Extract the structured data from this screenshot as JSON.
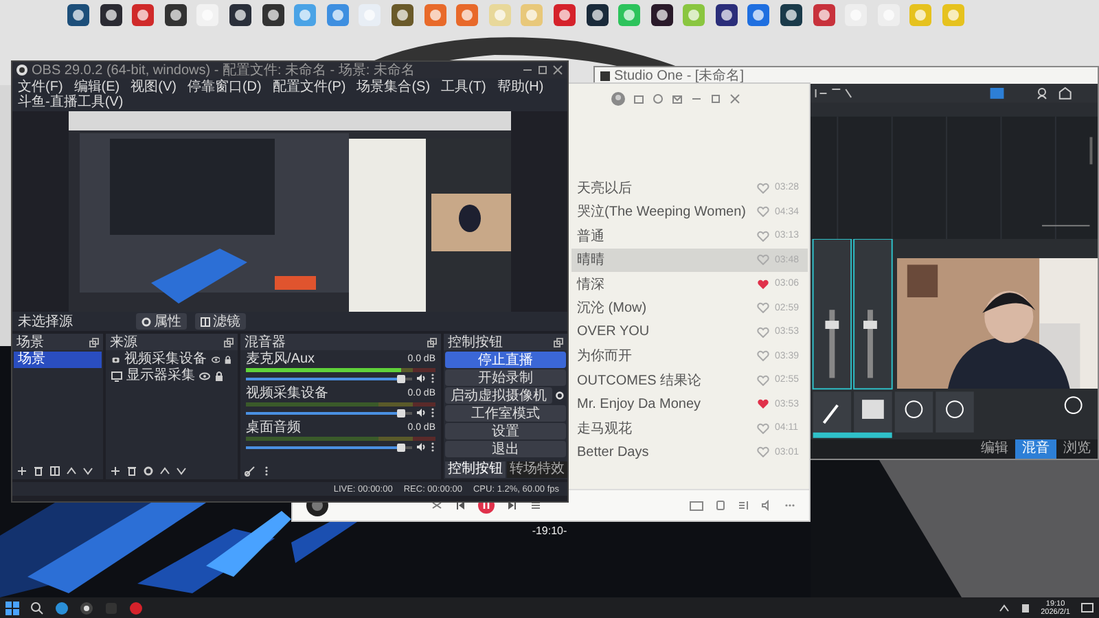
{
  "obs": {
    "title": "OBS 29.0.2 (64-bit, windows) - 配置文件: 未命名 - 场景: 未命名",
    "menu": [
      "文件(F)",
      "编辑(E)",
      "视图(V)",
      "停靠窗口(D)",
      "配置文件(P)",
      "场景集合(S)",
      "工具(T)",
      "帮助(H)",
      "斗鱼-直播工具(V)"
    ],
    "source_toolbar": {
      "no_source": "未选择源",
      "properties": "属性",
      "filters": "滤镜"
    },
    "scenes": {
      "title": "场景",
      "items": [
        {
          "label": "场景",
          "selected": true
        }
      ]
    },
    "sources": {
      "title": "来源",
      "items": [
        {
          "label": "视频采集设备",
          "kind": "camera"
        },
        {
          "label": "显示器采集",
          "kind": "display"
        }
      ]
    },
    "mixer": {
      "title": "混音器",
      "channels": [
        {
          "name": "麦克风/Aux",
          "reading": "0.0 dB",
          "meter": {
            "level": 0.82
          },
          "volume": {
            "level": 0.93
          }
        },
        {
          "name": "视频采集设备",
          "reading": "0.0 dB",
          "meter": {
            "level": 0
          },
          "volume": {
            "level": 0.93
          }
        },
        {
          "name": "桌面音频",
          "reading": "0.0 dB",
          "meter": {
            "level": 0
          },
          "volume": {
            "level": 0.93
          }
        }
      ]
    },
    "controls": {
      "title": "控制按钮",
      "buttons": [
        {
          "label": "停止直播",
          "kind": "primary"
        },
        {
          "label": "开始录制",
          "kind": "plain"
        },
        {
          "label": "启动虚拟摄像机",
          "kind": "gear"
        },
        {
          "label": "工作室模式",
          "kind": "plain"
        },
        {
          "label": "设置",
          "kind": "plain"
        },
        {
          "label": "退出",
          "kind": "plain"
        }
      ],
      "tabs": [
        {
          "label": "控制按钮",
          "selected": true
        },
        {
          "label": "转场特效",
          "selected": false
        }
      ]
    },
    "status": {
      "live": "LIVE: 00:00:00",
      "rec": "REC: 00:00:00",
      "cpu": "CPU: 1.2%, 60.00 fps"
    }
  },
  "studio_one": {
    "title": "Studio One - [未命名]",
    "pages": [
      {
        "label": "编辑",
        "selected": false
      },
      {
        "label": "混音",
        "selected": true
      },
      {
        "label": "浏览",
        "selected": false
      }
    ]
  },
  "music": {
    "songs": [
      {
        "title": "天亮以后",
        "liked": false,
        "duration": "03:28",
        "selected": false
      },
      {
        "title": "哭泣(The Weeping Women)",
        "liked": false,
        "duration": "04:34",
        "selected": false
      },
      {
        "title": "普通",
        "liked": false,
        "duration": "03:13",
        "selected": false
      },
      {
        "title": "晴晴",
        "liked": false,
        "duration": "03:48",
        "selected": true
      },
      {
        "title": "情深",
        "liked": true,
        "duration": "03:06",
        "selected": false
      },
      {
        "title": "沉沦 (Mow)",
        "liked": false,
        "duration": "02:59",
        "selected": false
      },
      {
        "title": "OVER YOU",
        "liked": false,
        "duration": "03:53",
        "selected": false
      },
      {
        "title": "为你而开",
        "liked": false,
        "duration": "03:39",
        "selected": false
      },
      {
        "title": "OUTCOMES 结果论",
        "liked": false,
        "duration": "02:55",
        "selected": false
      },
      {
        "title": "Mr. Enjoy Da Money",
        "liked": true,
        "duration": "03:53",
        "selected": false
      },
      {
        "title": "走马观花",
        "liked": false,
        "duration": "04:11",
        "selected": false
      },
      {
        "title": "Better Days",
        "liked": false,
        "duration": "03:01",
        "selected": false
      }
    ]
  },
  "desktop_clock": "-19:10-",
  "taskbar": {
    "time": "19:10",
    "date": "2026/2/1"
  }
}
